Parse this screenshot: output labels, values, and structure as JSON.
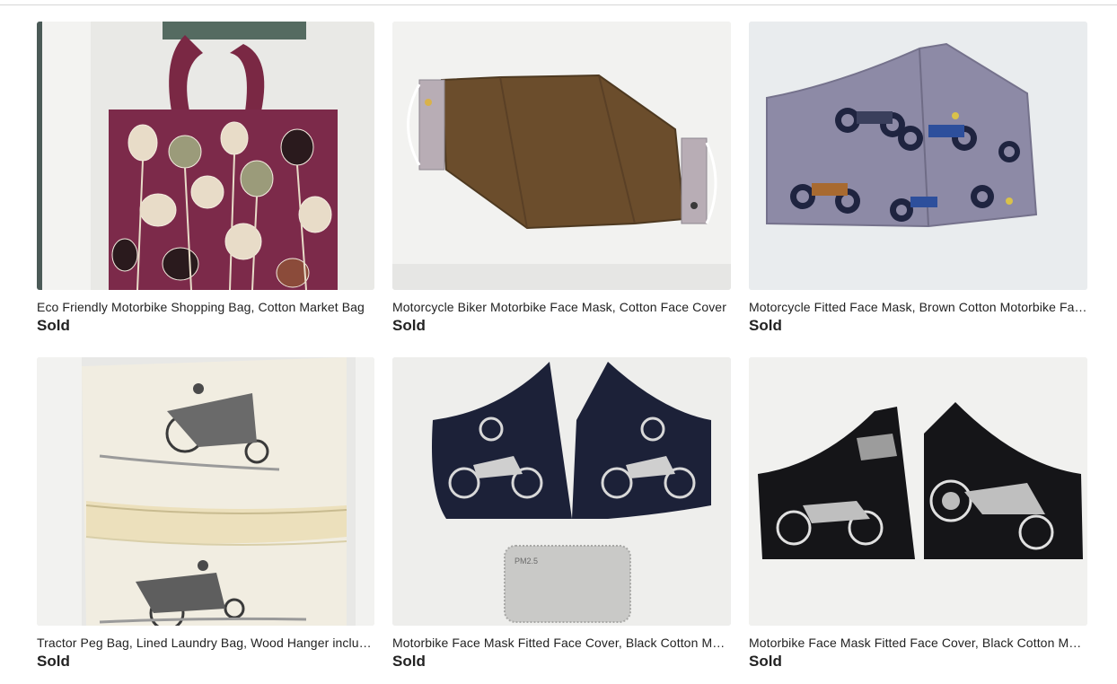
{
  "listings": [
    {
      "title": "Eco Friendly Motorbike Shopping Bag, Cotton Market Bag",
      "status": "Sold",
      "image": "purple-floral-tote-bag"
    },
    {
      "title": "Motorcycle Biker Motorbike Face Mask, Cotton Face Cover",
      "status": "Sold",
      "image": "brown-cotton-face-mask"
    },
    {
      "title": "Motorcycle Fitted Face Mask, Brown Cotton Motorbike Face Cover",
      "status": "Sold",
      "image": "grey-motorbike-print-mask"
    },
    {
      "title": "Tractor Peg Bag, Lined Laundry Bag, Wood Hanger included",
      "status": "Sold",
      "image": "cream-tractor-peg-bag"
    },
    {
      "title": "Motorbike Face Mask Fitted Face Cover, Black Cotton Mask",
      "status": "Sold",
      "image": "navy-motorbike-mask-with-filter"
    },
    {
      "title": "Motorbike Face Mask Fitted Face Cover, Black Cotton Mask",
      "status": "Sold",
      "image": "black-motorbike-print-masks"
    }
  ],
  "filter_label": "PM2.5"
}
